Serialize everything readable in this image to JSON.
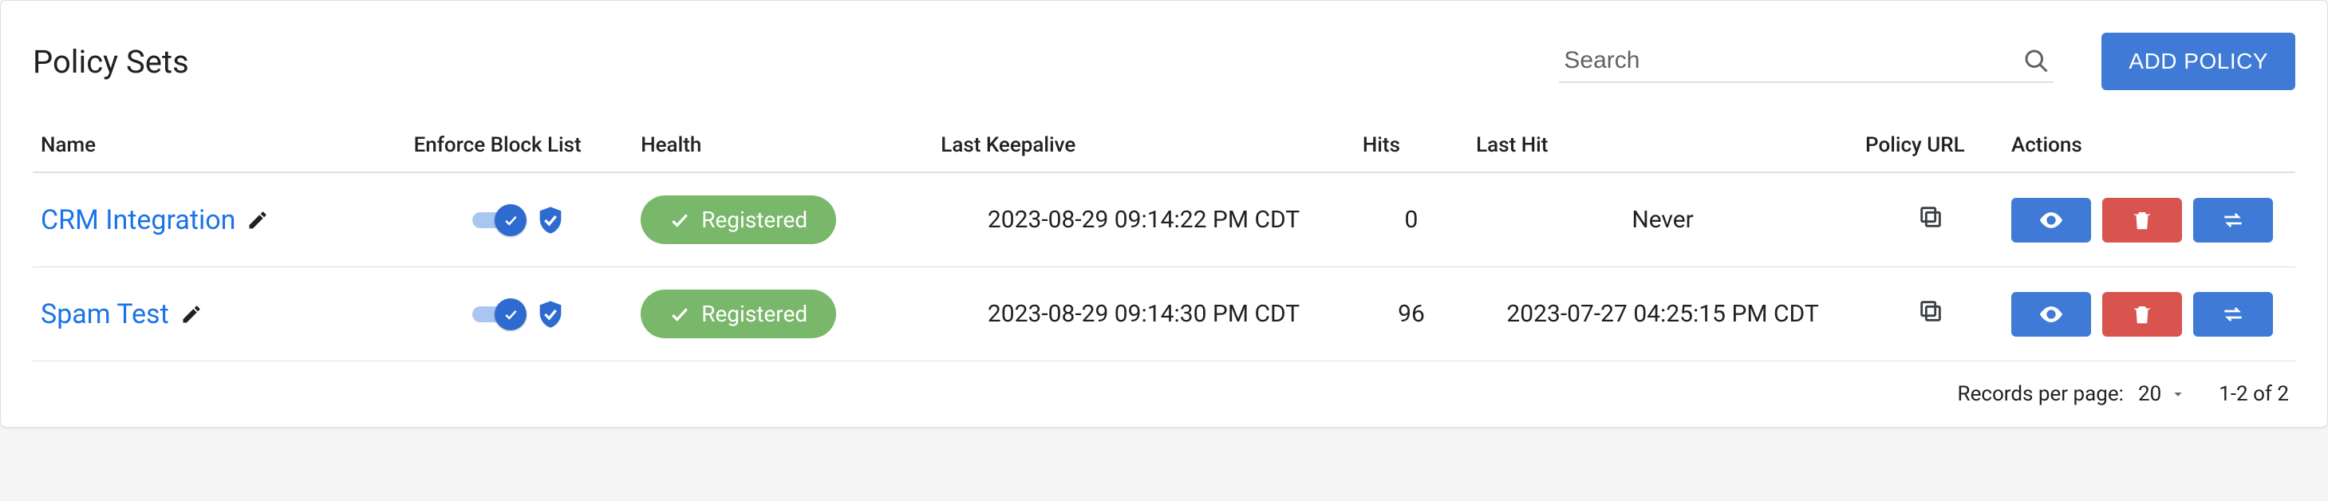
{
  "header": {
    "title": "Policy Sets",
    "search_placeholder": "Search",
    "add_label": "ADD POLICY"
  },
  "columns": {
    "name": "Name",
    "enforce": "Enforce Block List",
    "health": "Health",
    "keepalive": "Last Keepalive",
    "hits": "Hits",
    "lasthit": "Last Hit",
    "url": "Policy URL",
    "actions": "Actions"
  },
  "rows": [
    {
      "name": "CRM Integration",
      "enforce": true,
      "health": "Registered",
      "keepalive": "2023-08-29 09:14:22 PM CDT",
      "hits": "0",
      "lasthit": "Never"
    },
    {
      "name": "Spam Test",
      "enforce": true,
      "health": "Registered",
      "keepalive": "2023-08-29 09:14:30 PM CDT",
      "hits": "96",
      "lasthit": "2023-07-27 04:25:15 PM CDT"
    }
  ],
  "footer": {
    "per_page_label": "Records per page:",
    "per_page_value": "20",
    "range": "1-2 of 2"
  }
}
